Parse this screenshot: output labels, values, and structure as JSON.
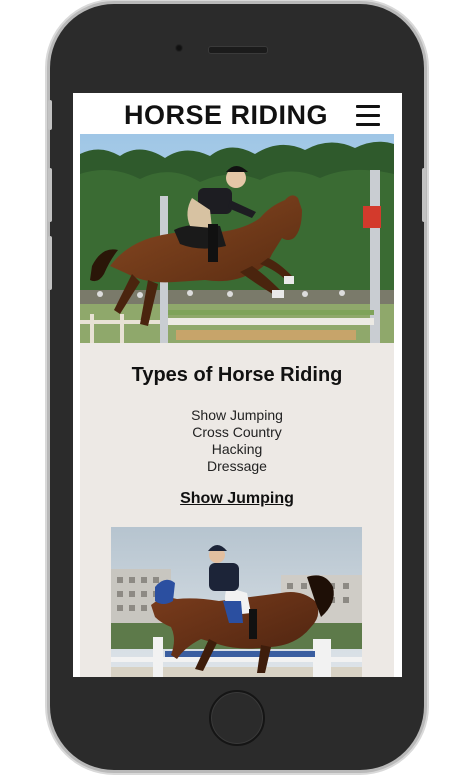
{
  "header": {
    "title": "HORSE RIDING",
    "menu_icon": "hamburger-menu-icon"
  },
  "hero": {
    "image": "show-jumping-rider-image"
  },
  "main": {
    "heading": "Types of Horse Riding",
    "types": [
      "Show Jumping",
      "Cross Country",
      "Hacking",
      "Dressage"
    ],
    "section_link": "Show Jumping",
    "section_image": "show-jumping-competition-image"
  },
  "colors": {
    "content_background": "#ede9e5",
    "phone_body": "#2b2b2b",
    "text": "#111111"
  }
}
